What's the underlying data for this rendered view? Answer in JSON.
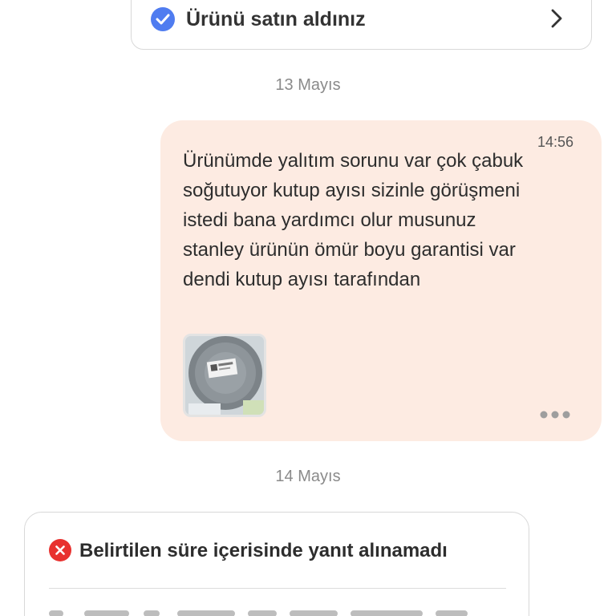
{
  "purchase": {
    "label": "Ürünü satın aldınız",
    "check_icon": "check-circle-icon",
    "chevron_icon": "chevron-right-icon",
    "accent": "#4f7cf0"
  },
  "dates": {
    "first": "13 Mayıs",
    "second": "14 Mayıs"
  },
  "message": {
    "time": "14:56",
    "text": "Ürünümde yalıtım sorunu var çok çabuk soğutuyor kutup ayısı sizinle görüşmeni istedi bana yardımcı olur musunuz stanley ürünün ömür boyu garantisi var dendi kutup ayısı tarafından",
    "attachment_label": "STANLEY",
    "more_icon": "more-horizontal-icon",
    "bubble_color": "#fdebe2"
  },
  "timeout": {
    "title": "Belirtilen süre içerisinde yanıt alınamadı",
    "icon": "error-circle-icon",
    "status_color": "#e8312f"
  }
}
